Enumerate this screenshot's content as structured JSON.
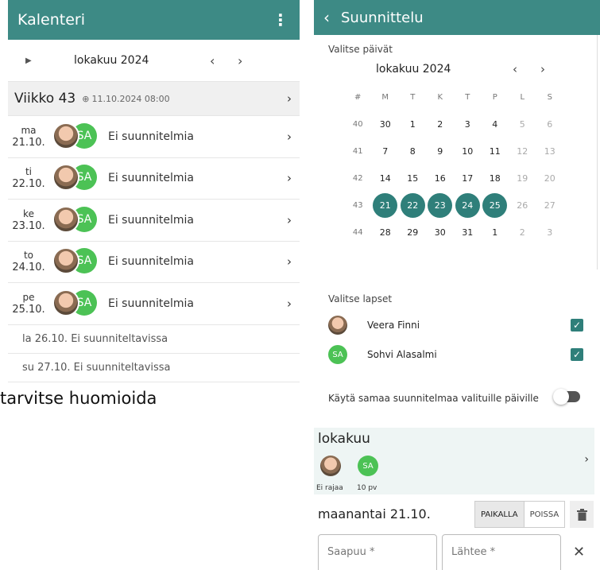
{
  "left": {
    "title": "Kalenteri",
    "menu_icon": "⋮",
    "month": "lokakuu 2024",
    "week": {
      "label": "Viikko 43",
      "lock_icon": "🔒",
      "lock_time": "11.10.2024 08:00"
    },
    "days": [
      {
        "weekday": "ma",
        "date": "21.10.",
        "status": "Ei suunnitelmia"
      },
      {
        "weekday": "ti",
        "date": "22.10.",
        "status": "Ei suunnitelmia"
      },
      {
        "weekday": "ke",
        "date": "23.10.",
        "status": "Ei suunnitelmia"
      },
      {
        "weekday": "to",
        "date": "24.10.",
        "status": "Ei suunnitelmia"
      },
      {
        "weekday": "pe",
        "date": "25.10.",
        "status": "Ei suunnitelmia"
      }
    ],
    "avatar_initials": "SA",
    "weekend": [
      "la 26.10. Ei suunniteltavissa",
      "su 27.10. Ei suunniteltavissa"
    ],
    "caption": "tarvitse huomioida"
  },
  "right": {
    "title": "Suunnittelu",
    "select_days_label": "Valitse päivät",
    "calendar": {
      "month": "lokakuu 2024",
      "headers": [
        "#",
        "M",
        "T",
        "K",
        "T",
        "P",
        "L",
        "S"
      ],
      "weeks": [
        {
          "wn": "40",
          "days": [
            "30",
            "1",
            "2",
            "3",
            "4",
            "5",
            "6"
          ]
        },
        {
          "wn": "41",
          "days": [
            "7",
            "8",
            "9",
            "10",
            "11",
            "12",
            "13"
          ]
        },
        {
          "wn": "42",
          "days": [
            "14",
            "15",
            "16",
            "17",
            "18",
            "19",
            "20"
          ]
        },
        {
          "wn": "43",
          "days": [
            "21",
            "22",
            "23",
            "24",
            "25",
            "26",
            "27"
          ]
        },
        {
          "wn": "44",
          "days": [
            "28",
            "29",
            "30",
            "31",
            "1",
            "2",
            "3"
          ]
        }
      ],
      "selected": [
        "21",
        "22",
        "23",
        "24",
        "25"
      ]
    },
    "select_children_label": "Valitse lapset",
    "children": [
      {
        "name": "Veera Finni",
        "checked": true
      },
      {
        "name": "Sohvi Alasalmi",
        "initials": "SA",
        "checked": true
      }
    ],
    "same_plan_label": "Käytä samaa suunnitelmaa valituille päiville",
    "month_card": {
      "title": "lokakuu",
      "initials": "SA",
      "label1": "Ei rajaa",
      "label2": "10 pv"
    },
    "day_title": "maanantai 21.10.",
    "present_label": "PAIKALLA",
    "absent_label": "POISSA",
    "arrive_placeholder": "Saapuu *",
    "leave_placeholder": "Lähtee *",
    "accent_color": "#3d8a85",
    "selected_color": "#2f7f7a",
    "avatar_color": "#4cc255"
  }
}
